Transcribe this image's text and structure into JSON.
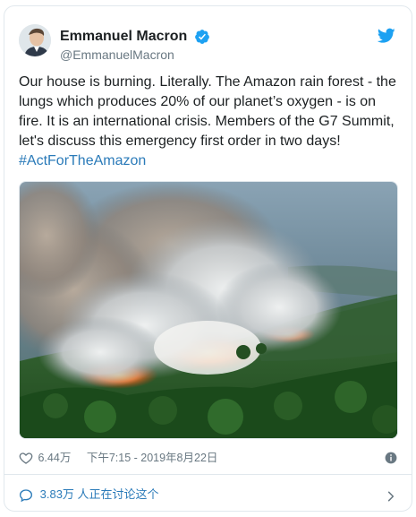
{
  "author": {
    "display_name": "Emmanuel Macron",
    "handle": "@EmmanuelMacron",
    "verified": true
  },
  "tweet": {
    "text": "Our house is burning. Literally. The Amazon rain forest - the lungs which produces 20% of our planet’s oxygen - is on fire. It is an international crisis. Members of the G7 Summit, let's discuss this emergency first order in two days!",
    "hashtag": "#ActForTheAmazon"
  },
  "stats": {
    "likes": "6.44万",
    "timestamp": "下午7:15 - 2019年8月22日"
  },
  "footer": {
    "discussion": "3.83万 人正在讨论这个"
  },
  "colors": {
    "link": "#2b7bb9",
    "twitter_blue": "#1da1f2",
    "muted": "#697882",
    "border": "#e1e8ed"
  },
  "icons": {
    "verified": "verified-badge-icon",
    "bird": "twitter-bird-icon",
    "heart": "heart-icon",
    "info": "info-icon",
    "reply": "speech-bubble-icon",
    "chevron": "chevron-right-icon"
  }
}
